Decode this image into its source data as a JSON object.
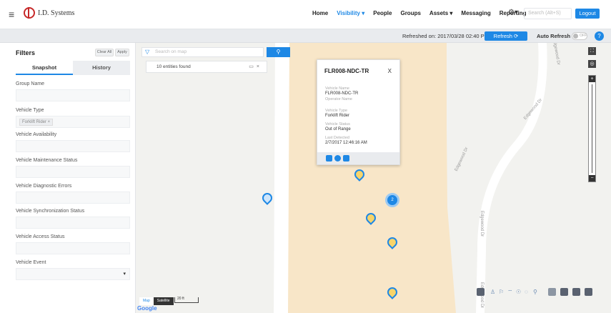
{
  "header": {
    "brand": "I.D. Systems",
    "nav": [
      "Home",
      "Visibility ▾",
      "People",
      "Groups",
      "Assets ▾",
      "Messaging",
      "Reporting"
    ],
    "search_placeholder": "Search (Alt+S)",
    "logout": "Logout"
  },
  "subbar": {
    "refreshed": "Refreshed on: 2017/03/28 02:40 PM",
    "refresh_btn": "Refresh",
    "auto_refresh": "Auto Refresh",
    "toggle_state": "OFF",
    "help": "?"
  },
  "filters": {
    "title": "Filters",
    "clear_all": "Clear All",
    "apply": "Apply",
    "tabs": [
      "Snapshot",
      "History"
    ],
    "fields": [
      {
        "label": "Group Name",
        "chip": ""
      },
      {
        "label": "Vehicle Type",
        "chip": "Forklift Rider ×"
      },
      {
        "label": "Vehicle Availability",
        "chip": ""
      },
      {
        "label": "Vehicle Maintenance Status",
        "chip": ""
      },
      {
        "label": "Vehicle Diagnostic Errors",
        "chip": ""
      },
      {
        "label": "Vehicle Synchronization Status",
        "chip": ""
      },
      {
        "label": "Vehicle Access Status",
        "chip": ""
      },
      {
        "label": "Vehicle Event",
        "chip": ""
      }
    ]
  },
  "map": {
    "search_placeholder": "Search on map",
    "found": "10 entities found",
    "cluster_count": "2",
    "roads": [
      "Edgewood Dr",
      "Edgewood Dr",
      "Edgewood Dr",
      "Edgewood Dr",
      "Edgewood Dr"
    ],
    "map_types": [
      "Map",
      "Satellite"
    ],
    "scale": "20 ft",
    "google": "Google",
    "popup": {
      "title": "FLR008-NDC-TR",
      "close": "X",
      "rows": [
        {
          "k": "Vehicle Name",
          "v": "FLR008-NDC-TR"
        },
        {
          "k": "Operator Name",
          "v": ""
        },
        {
          "k": "Vehicle Type",
          "v": "Forklift Rider"
        },
        {
          "k": "Vehicle Status",
          "v": "Out of Range"
        },
        {
          "k": "Last Detected",
          "v": "2/7/2017 12:46:16 AM"
        }
      ]
    }
  },
  "colors": {
    "accent": "#1e88e5",
    "pin": "#f7d46a",
    "building": "#f8e6c8"
  }
}
